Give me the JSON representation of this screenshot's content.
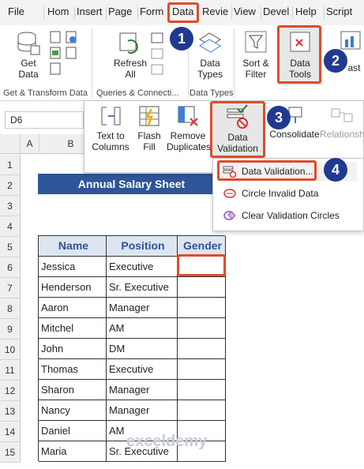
{
  "tabs": [
    "File",
    "Home",
    "Insert",
    "Page",
    "Form",
    "Data",
    "Revie",
    "View",
    "Devel",
    "Help",
    "Script"
  ],
  "tabs_visible": [
    "File",
    "Hom",
    "Insert",
    "Page",
    "Form",
    "Data",
    "Revie",
    "View",
    "Devel",
    "Help",
    "Script"
  ],
  "ribbon": {
    "get_data": [
      "Get",
      "Data"
    ],
    "refresh": [
      "Refresh",
      "All"
    ],
    "data_types": [
      "Data",
      "Types"
    ],
    "sort_filter": [
      "Sort &",
      "Filter"
    ],
    "data_tools": [
      "Data",
      "Tools"
    ],
    "forecast": "ast",
    "groups": [
      "Get & Transform Data",
      "Queries & Connecti...",
      "Data Types"
    ]
  },
  "data_tools_menu": {
    "text_to_columns": [
      "Text to",
      "Columns"
    ],
    "flash_fill": [
      "Flash",
      "Fill"
    ],
    "remove_duplicates": [
      "Remove",
      "Duplicates"
    ],
    "data_validation": [
      "Data",
      "Validation"
    ],
    "consolidate": "Consolidate",
    "relationships": "Relationsh"
  },
  "validation_menu": [
    "Data Validation...",
    "Circle Invalid Data",
    "Clear Validation Circles"
  ],
  "name_box": "D6",
  "columns": [
    "A",
    "B"
  ],
  "rows": [
    "1",
    "2",
    "3",
    "4",
    "5",
    "6",
    "7",
    "8",
    "9",
    "10",
    "11",
    "12",
    "13",
    "14",
    "15"
  ],
  "sheet": {
    "title": "Annual Salary Sheet",
    "headers": [
      "Name",
      "Position",
      "Gender"
    ],
    "records": [
      [
        "Jessica",
        "Executive"
      ],
      [
        "Henderson",
        "Sr. Executive"
      ],
      [
        "Aaron",
        "Manager"
      ],
      [
        "Mitchel",
        "AM"
      ],
      [
        "John",
        "DM"
      ],
      [
        "Thomas",
        "Executive"
      ],
      [
        "Sharon",
        "Manager"
      ],
      [
        "Nancy",
        "Manager"
      ],
      [
        "Daniel",
        "AM"
      ],
      [
        "Maria",
        "Sr. Executive"
      ]
    ]
  },
  "steps": [
    "1",
    "2",
    "3",
    "4"
  ],
  "watermark": "exceldemy",
  "colors": {
    "accent": "#e04c2c",
    "badge": "#1f3a8f",
    "title_bg": "#2e5597",
    "header_bg": "#dde5f1",
    "header_text": "#2e5597"
  }
}
